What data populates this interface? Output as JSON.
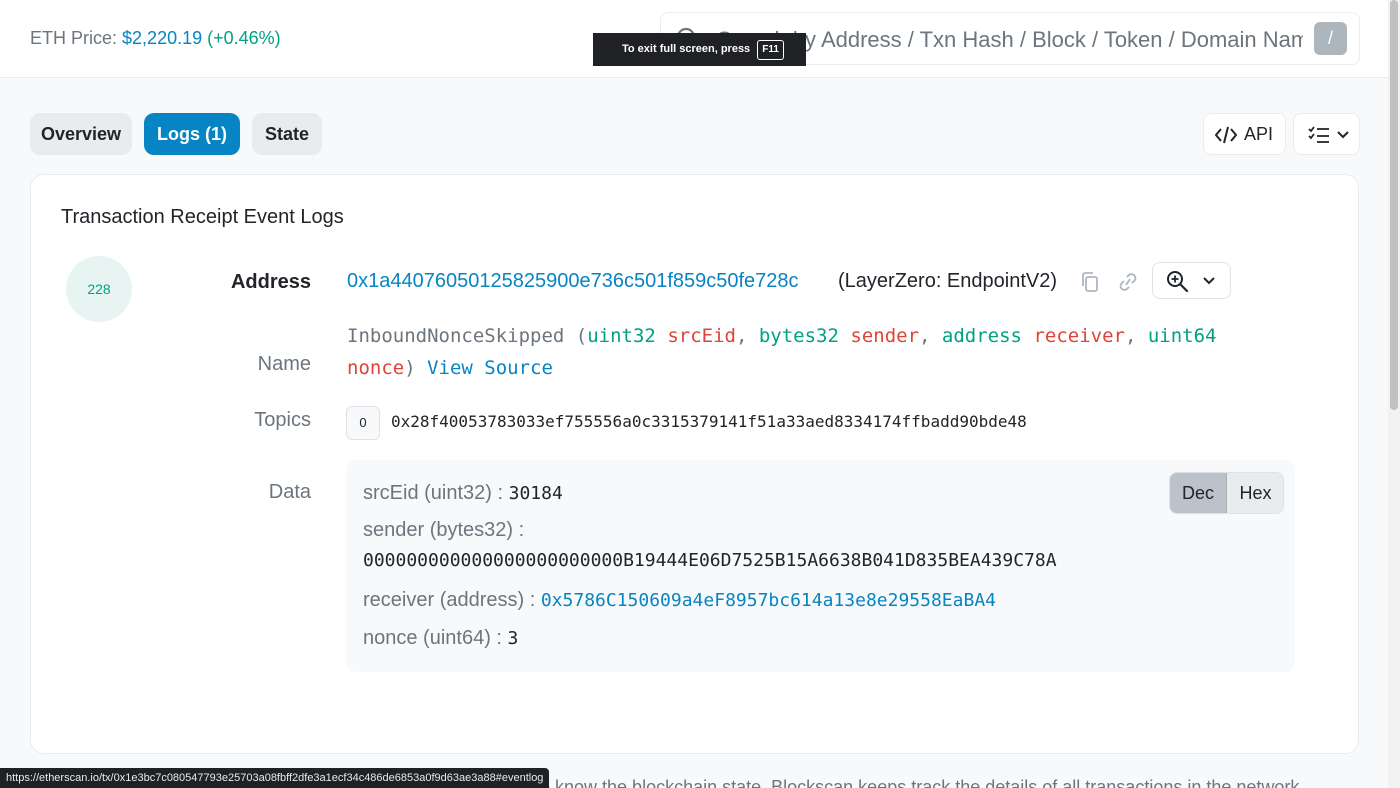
{
  "header": {
    "eth_price_label": "ETH Price:",
    "eth_price_value": "$2,220.19",
    "eth_price_change": "(+0.46%)",
    "search_placeholder": "Search by Address / Txn Hash / Block / Token / Domain Name",
    "search_shortcut": "/"
  },
  "fullscreen_tip": {
    "text": "To exit full screen, press",
    "key": "F11"
  },
  "tabs": [
    {
      "label": "Overview",
      "active": false
    },
    {
      "label": "Logs (1)",
      "active": true
    },
    {
      "label": "State",
      "active": false
    }
  ],
  "toolbar": {
    "api_label": "API"
  },
  "card": {
    "title": "Transaction Receipt Event Logs",
    "log_index": "228",
    "labels": {
      "address": "Address",
      "name": "Name",
      "topics": "Topics",
      "data": "Data"
    },
    "address": "0x1a44076050125825900e736c501f859c50fe728c",
    "address_name": "(LayerZero: EndpointV2)",
    "signature": {
      "event": "InboundNonceSkipped",
      "open": " (",
      "params": [
        {
          "type": "uint32",
          "name": "srcEid",
          "sep": ", "
        },
        {
          "type": "bytes32",
          "name": "sender",
          "sep": ", "
        },
        {
          "type": "address",
          "name": "receiver",
          "sep": ", "
        },
        {
          "type": "uint64",
          "name": "nonce",
          "sep": ""
        }
      ],
      "close": ")",
      "view_source": "View Source"
    },
    "topics": [
      {
        "index": "0",
        "value": "0x28f40053783033ef755556a0c3315379141f51a33aed8334174ffbadd90bde48"
      }
    ],
    "data": {
      "toggle": {
        "dec": "Dec",
        "hex": "Hex",
        "selected": "Dec"
      },
      "rows": [
        {
          "label": "srcEid (uint32) :",
          "value": "30184"
        },
        {
          "label": "sender (bytes32) :",
          "value": "000000000000000000000000B19444E06D7525B15A6638B041D835BEA439C78A"
        },
        {
          "label": "receiver (address) :",
          "value": "0x5786C150609a4eF8957bc614a13e8e29558EaBA4"
        },
        {
          "label": "nonce (uint64) :",
          "value": "3"
        }
      ]
    }
  },
  "status_bar": {
    "url": "https://etherscan.io/tx/0x1e3bc7c080547793e25703a08fbff2dfe3a1ecf34c486de6853a0f9d63ae3a88#eventlog"
  },
  "bottom_text": "...to know the blockchain state. Blockscan keeps track the details of all transactions in the network..."
}
